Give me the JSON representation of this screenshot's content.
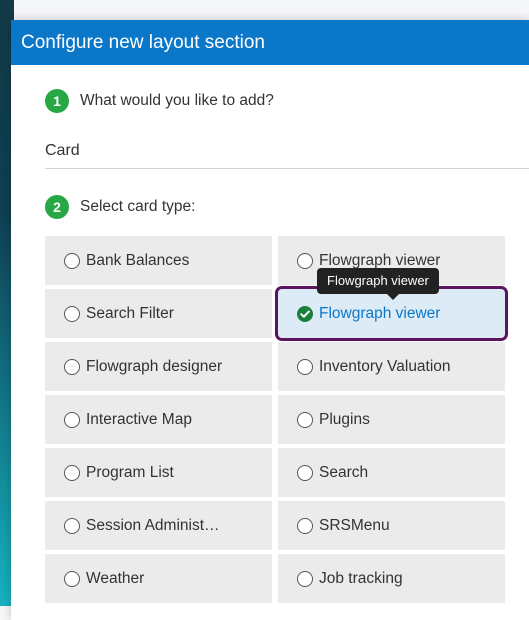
{
  "dialog": {
    "title": "Configure new layout section"
  },
  "steps": {
    "step1": {
      "number": "1",
      "label": "What would you like to add?"
    },
    "selected_value": "Card",
    "step2": {
      "number": "2",
      "label": "Select card type:"
    }
  },
  "card_types": [
    {
      "label": "Bank Balances",
      "selected": false
    },
    {
      "label": "Flowgraph viewer",
      "selected": false
    },
    {
      "label": "Search Filter",
      "selected": false
    },
    {
      "label": "Flowgraph viewer",
      "selected": true
    },
    {
      "label": "Flowgraph designer",
      "selected": false
    },
    {
      "label": "Inventory Valuation",
      "selected": false
    },
    {
      "label": "Interactive Map",
      "selected": false
    },
    {
      "label": "Plugins",
      "selected": false
    },
    {
      "label": "Program List",
      "selected": false
    },
    {
      "label": "Search",
      "selected": false
    },
    {
      "label": "Session Administ…",
      "selected": false
    },
    {
      "label": "SRSMenu",
      "selected": false
    },
    {
      "label": "Weather",
      "selected": false
    },
    {
      "label": "Job tracking",
      "selected": false
    }
  ],
  "tooltip": {
    "text": "Flowgraph viewer"
  },
  "colors": {
    "header": "#0a77c9",
    "step_badge": "#27a745",
    "selected_outline": "#5d1460",
    "selected_fill": "#dcebf6",
    "card_fill": "#ebebeb"
  }
}
